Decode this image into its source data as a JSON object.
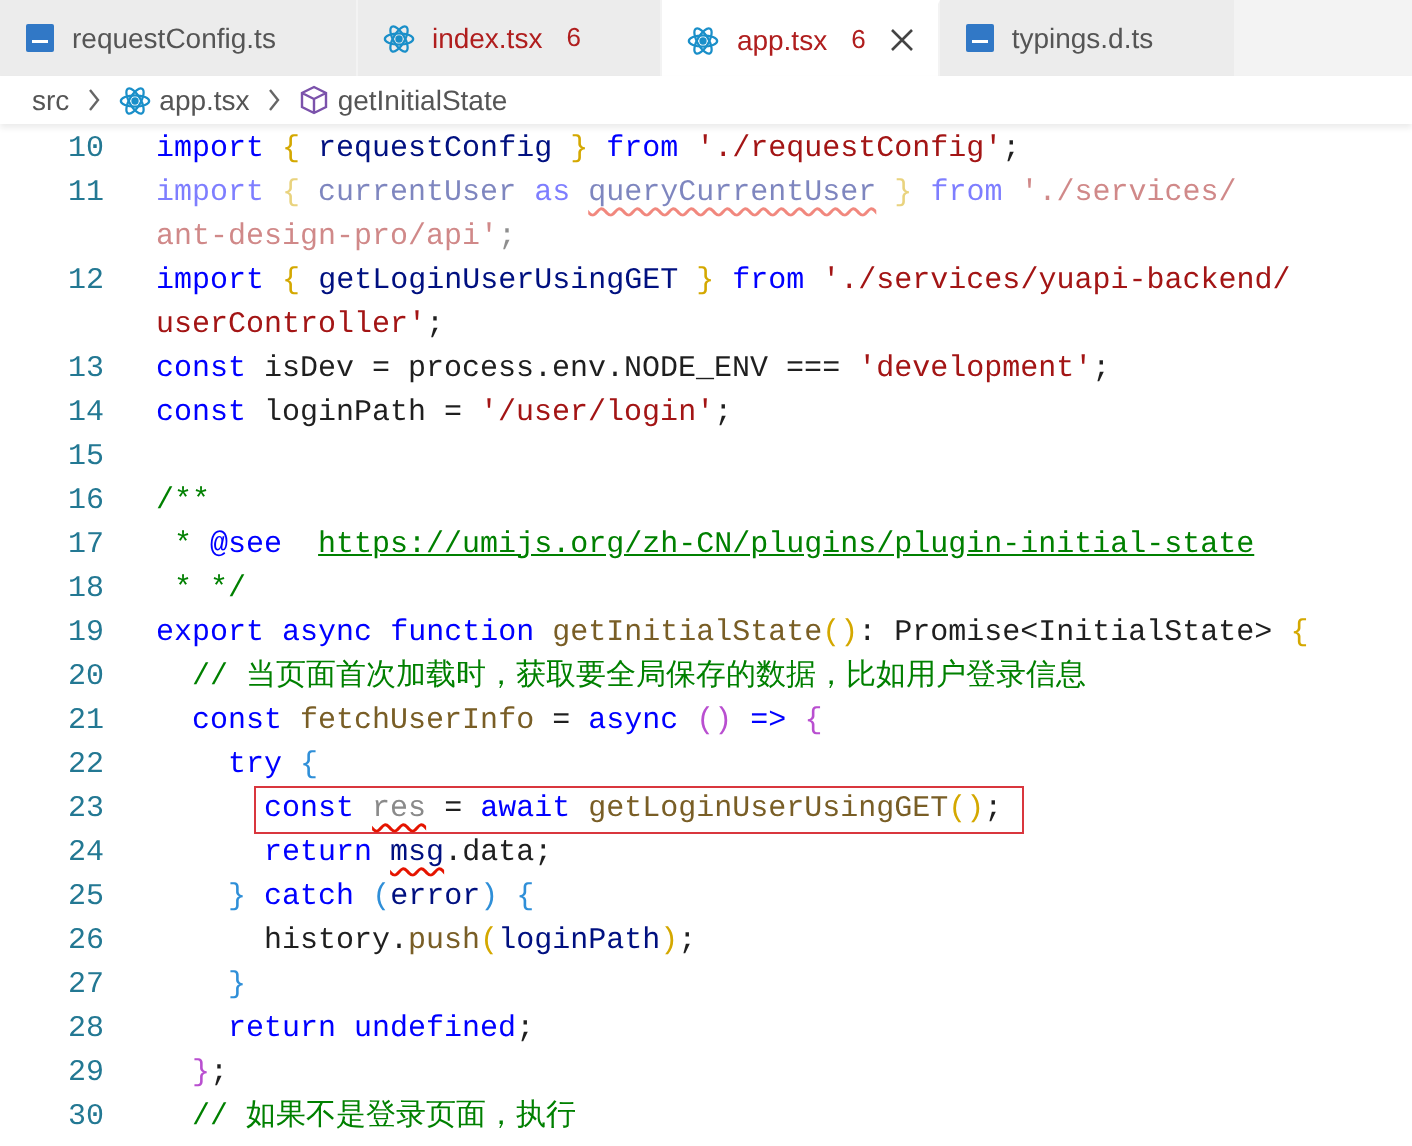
{
  "tabs": [
    {
      "label": "requestConfig.ts",
      "kind": "ts",
      "error": false,
      "selected": false
    },
    {
      "label": "index.tsx",
      "kind": "react",
      "problems": "6",
      "error": true,
      "selected": false
    },
    {
      "label": "app.tsx",
      "kind": "react",
      "problems": "6",
      "error": true,
      "selected": true
    },
    {
      "label": "typings.d.ts",
      "kind": "ts",
      "error": false,
      "selected": false
    }
  ],
  "breadcrumb": [
    {
      "label": "src",
      "kind": "folder"
    },
    {
      "label": "app.tsx",
      "kind": "react"
    },
    {
      "label": "getInitialState",
      "kind": "symbol"
    }
  ],
  "lines": [
    {
      "number": "10",
      "rows": [
        [
          {
            "kind": "kw",
            "text": "import"
          },
          {
            "kind": "plain",
            "text": " "
          },
          {
            "kind": "b1",
            "text": "{"
          },
          {
            "kind": "var",
            "text": " requestConfig "
          },
          {
            "kind": "b1",
            "text": "}"
          },
          {
            "kind": "plain",
            "text": " "
          },
          {
            "kind": "kw",
            "text": "from"
          },
          {
            "kind": "plain",
            "text": " "
          },
          {
            "kind": "str",
            "text": "'./requestConfig'"
          },
          {
            "kind": "plain",
            "text": ";"
          }
        ]
      ]
    },
    {
      "number": "11",
      "faded": true,
      "rows": [
        [
          {
            "kind": "kw",
            "text": "import"
          },
          {
            "kind": "plain",
            "text": " "
          },
          {
            "kind": "b1",
            "text": "{"
          },
          {
            "kind": "var",
            "text": " currentUser "
          },
          {
            "kind": "kw",
            "text": "as"
          },
          {
            "kind": "plain",
            "text": " "
          },
          {
            "kind": "var",
            "text": "queryCurrentUser",
            "squiggle": true
          },
          {
            "kind": "plain",
            "text": " "
          },
          {
            "kind": "b1",
            "text": "}"
          },
          {
            "kind": "plain",
            "text": " "
          },
          {
            "kind": "kw",
            "text": "from"
          },
          {
            "kind": "plain",
            "text": " "
          },
          {
            "kind": "str",
            "text": "'./services/"
          }
        ],
        [
          {
            "kind": "str",
            "text": "ant-design-pro/api'"
          },
          {
            "kind": "plain",
            "text": ";"
          }
        ]
      ]
    },
    {
      "number": "12",
      "rows": [
        [
          {
            "kind": "kw",
            "text": "import"
          },
          {
            "kind": "plain",
            "text": " "
          },
          {
            "kind": "b1",
            "text": "{"
          },
          {
            "kind": "plain",
            "text": " "
          },
          {
            "kind": "var",
            "text": "getLoginUserUsingGET"
          },
          {
            "kind": "plain",
            "text": " "
          },
          {
            "kind": "b1",
            "text": "}"
          },
          {
            "kind": "plain",
            "text": " "
          },
          {
            "kind": "kw",
            "text": "from"
          },
          {
            "kind": "plain",
            "text": " "
          },
          {
            "kind": "str",
            "text": "'./services/yuapi-backend/"
          }
        ],
        [
          {
            "kind": "str",
            "text": "userController'"
          },
          {
            "kind": "plain",
            "text": ";"
          }
        ]
      ]
    },
    {
      "number": "13",
      "rows": [
        [
          {
            "kind": "kw",
            "text": "const"
          },
          {
            "kind": "plain",
            "text": " isDev = process.env.NODE_ENV === "
          },
          {
            "kind": "str",
            "text": "'development'"
          },
          {
            "kind": "plain",
            "text": ";"
          }
        ]
      ]
    },
    {
      "number": "14",
      "rows": [
        [
          {
            "kind": "kw",
            "text": "const"
          },
          {
            "kind": "plain",
            "text": " loginPath = "
          },
          {
            "kind": "str",
            "text": "'/user/login'"
          },
          {
            "kind": "plain",
            "text": ";"
          }
        ]
      ]
    },
    {
      "number": "15",
      "rows": [
        []
      ]
    },
    {
      "number": "16",
      "rows": [
        [
          {
            "kind": "com",
            "text": "/**"
          }
        ]
      ]
    },
    {
      "number": "17",
      "rows": [
        [
          {
            "kind": "com",
            "text": " * "
          },
          {
            "kind": "tag",
            "text": "@see"
          },
          {
            "kind": "com",
            "text": "  "
          },
          {
            "kind": "link",
            "text": "https://umijs.org/zh-CN/plugins/plugin-initial-state"
          }
        ]
      ]
    },
    {
      "number": "18",
      "rows": [
        [
          {
            "kind": "com",
            "text": " * */"
          }
        ]
      ]
    },
    {
      "number": "19",
      "rows": [
        [
          {
            "kind": "kw",
            "text": "export"
          },
          {
            "kind": "plain",
            "text": " "
          },
          {
            "kind": "kw",
            "text": "async"
          },
          {
            "kind": "plain",
            "text": " "
          },
          {
            "kind": "kw",
            "text": "function"
          },
          {
            "kind": "plain",
            "text": " "
          },
          {
            "kind": "fn",
            "text": "getInitialState"
          },
          {
            "kind": "b1",
            "text": "()"
          },
          {
            "kind": "plain",
            "text": ": Promise<InitialState> "
          },
          {
            "kind": "b1",
            "text": "{"
          }
        ]
      ]
    },
    {
      "number": "20",
      "rows": [
        [
          {
            "kind": "plain",
            "text": "  "
          },
          {
            "kind": "com",
            "text": "// 当页面首次加载时，获取要全局保存的数据，比如用户登录信息"
          }
        ]
      ]
    },
    {
      "number": "21",
      "rows": [
        [
          {
            "kind": "plain",
            "text": "  "
          },
          {
            "kind": "kw",
            "text": "const"
          },
          {
            "kind": "plain",
            "text": " "
          },
          {
            "kind": "fn",
            "text": "fetchUserInfo"
          },
          {
            "kind": "plain",
            "text": " = "
          },
          {
            "kind": "kw",
            "text": "async"
          },
          {
            "kind": "plain",
            "text": " "
          },
          {
            "kind": "b2",
            "text": "()"
          },
          {
            "kind": "plain",
            "text": " "
          },
          {
            "kind": "kw",
            "text": "=>"
          },
          {
            "kind": "plain",
            "text": " "
          },
          {
            "kind": "b2",
            "text": "{"
          }
        ]
      ]
    },
    {
      "number": "22",
      "rows": [
        [
          {
            "kind": "plain",
            "text": "    "
          },
          {
            "kind": "kw",
            "text": "try"
          },
          {
            "kind": "plain",
            "text": " "
          },
          {
            "kind": "b3",
            "text": "{"
          }
        ]
      ]
    },
    {
      "number": "23",
      "boxed": true,
      "rows": [
        [
          {
            "kind": "plain",
            "text": "      "
          },
          {
            "kind": "kw",
            "text": "const"
          },
          {
            "kind": "plain",
            "text": " "
          },
          {
            "kind": "dim",
            "text": "res",
            "squiggle": true
          },
          {
            "kind": "plain",
            "text": " = "
          },
          {
            "kind": "kw",
            "text": "await"
          },
          {
            "kind": "plain",
            "text": " "
          },
          {
            "kind": "fn",
            "text": "getLoginUserUsingGET"
          },
          {
            "kind": "b1",
            "text": "()"
          },
          {
            "kind": "plain",
            "text": ";"
          }
        ]
      ]
    },
    {
      "number": "24",
      "rows": [
        [
          {
            "kind": "plain",
            "text": "      "
          },
          {
            "kind": "kw",
            "text": "return"
          },
          {
            "kind": "plain",
            "text": " "
          },
          {
            "kind": "var",
            "text": "msg",
            "squiggle": true
          },
          {
            "kind": "plain",
            "text": ".data;"
          }
        ]
      ]
    },
    {
      "number": "25",
      "rows": [
        [
          {
            "kind": "plain",
            "text": "    "
          },
          {
            "kind": "b3",
            "text": "}"
          },
          {
            "kind": "plain",
            "text": " "
          },
          {
            "kind": "kw",
            "text": "catch"
          },
          {
            "kind": "plain",
            "text": " "
          },
          {
            "kind": "b3",
            "text": "("
          },
          {
            "kind": "var",
            "text": "error"
          },
          {
            "kind": "b3",
            "text": ")"
          },
          {
            "kind": "plain",
            "text": " "
          },
          {
            "kind": "b3",
            "text": "{"
          }
        ]
      ]
    },
    {
      "number": "26",
      "rows": [
        [
          {
            "kind": "plain",
            "text": "      history."
          },
          {
            "kind": "fn",
            "text": "push"
          },
          {
            "kind": "b1",
            "text": "("
          },
          {
            "kind": "var",
            "text": "loginPath"
          },
          {
            "kind": "b1",
            "text": ")"
          },
          {
            "kind": "plain",
            "text": ";"
          }
        ]
      ]
    },
    {
      "number": "27",
      "rows": [
        [
          {
            "kind": "plain",
            "text": "    "
          },
          {
            "kind": "b3",
            "text": "}"
          }
        ]
      ]
    },
    {
      "number": "28",
      "rows": [
        [
          {
            "kind": "plain",
            "text": "    "
          },
          {
            "kind": "kw",
            "text": "return"
          },
          {
            "kind": "plain",
            "text": " "
          },
          {
            "kind": "kw",
            "text": "undefined"
          },
          {
            "kind": "plain",
            "text": ";"
          }
        ]
      ]
    },
    {
      "number": "29",
      "rows": [
        [
          {
            "kind": "plain",
            "text": "  "
          },
          {
            "kind": "b2",
            "text": "}"
          },
          {
            "kind": "plain",
            "text": ";"
          }
        ]
      ]
    },
    {
      "number": "30",
      "rows": [
        [
          {
            "kind": "plain",
            "text": "  "
          },
          {
            "kind": "com",
            "text": "// 如果不是登录页面，执行"
          }
        ]
      ]
    }
  ]
}
